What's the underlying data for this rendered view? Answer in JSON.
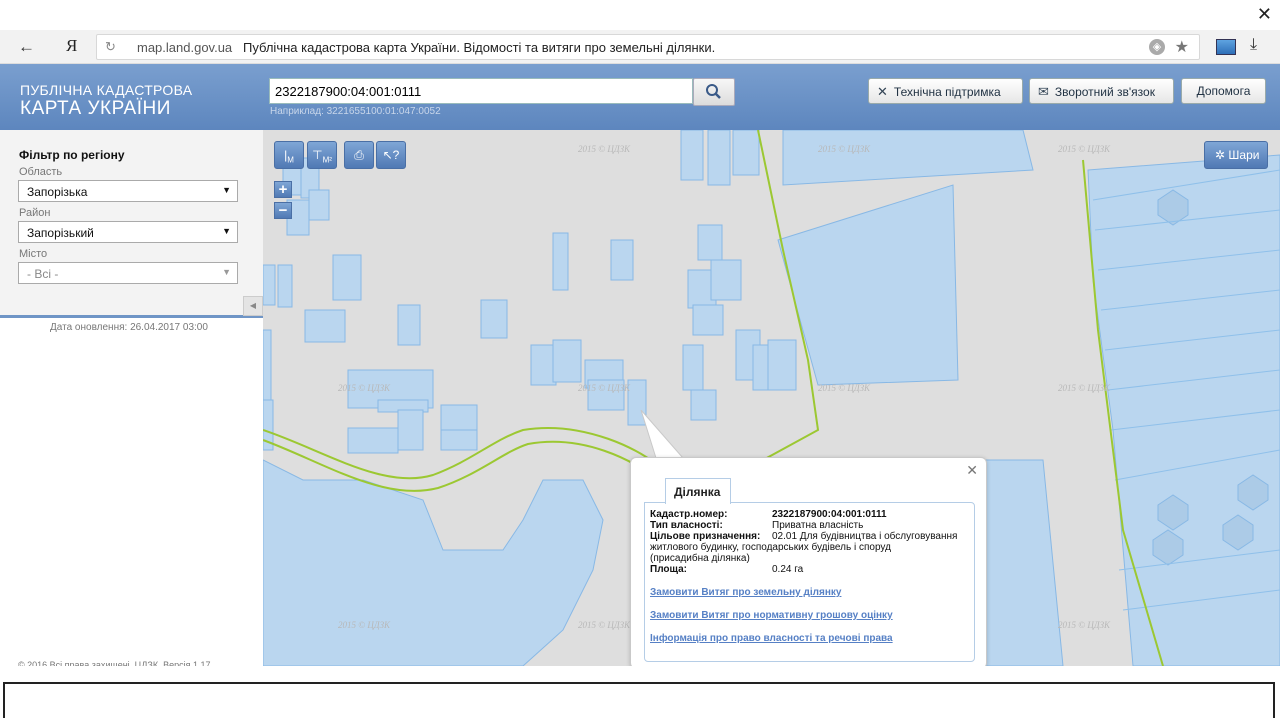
{
  "browser": {
    "host": "map.land.gov.ua",
    "title": "Публічна кадастрова карта України. Відомості та витяги про земельні ділянки.",
    "logo": "Я",
    "back_icon": "←",
    "close_icon": "✕"
  },
  "header": {
    "logo_line1": "ПУБЛІЧНА КАДАСТРОВА",
    "logo_line2": "КАРТА УКРАЇНИ",
    "search_value": "2322187900:04:001:0111",
    "search_hint": "Наприклад: 3221655100:01:047:0052",
    "buttons": {
      "support": "Технічна підтримка",
      "feedback": "Зворотний зв'язок",
      "help": "Допомога"
    }
  },
  "sidebar": {
    "filter_title": "Фільтр по регіону",
    "region_label": "Область",
    "region_value": "Запорізька",
    "district_label": "Район",
    "district_value": "Запорізький",
    "city_label": "Місто",
    "city_value": "- Всі -",
    "update_date": "Дата оновлення: 26.04.2017 03:00",
    "copyright": "© 2016 Всі права захищені. ЦДЗК. Версія 1.17"
  },
  "map": {
    "layers_label": "Шари",
    "watermark": "2015 © ЦДЗК",
    "toolbar": {
      "measure_m": "M",
      "measure_m2": "M²",
      "zoom_in": "+",
      "zoom_out": "−"
    }
  },
  "popup": {
    "tab_label": "Ділянка",
    "fields": [
      {
        "key": "Кадастр.номер:",
        "value": "2322187900:04:001:0111"
      },
      {
        "key": "Тип власності:",
        "value": "Приватна власність"
      },
      {
        "key": "Цільове призначення:",
        "value": "02.01 Для будівництва і обслуговування"
      },
      {
        "key": "",
        "value": "житлового будинку, господарських будівель і споруд"
      },
      {
        "key": "",
        "value": "(присадибна ділянка)"
      },
      {
        "key": "Площа:",
        "value": "0.24 га"
      }
    ],
    "links": [
      "Замовити Витяг про земельну ділянку",
      "Замовити Витяг про нормативну грошову оцінку",
      "Інформація про право власності та речові права"
    ]
  },
  "colors": {
    "header_bg": "#6a92c6",
    "parcel_fill": "#b9d6f0",
    "parcel_stroke": "#84b7e6",
    "boundary_green": "#9cc832",
    "map_bg": "#dedede"
  }
}
